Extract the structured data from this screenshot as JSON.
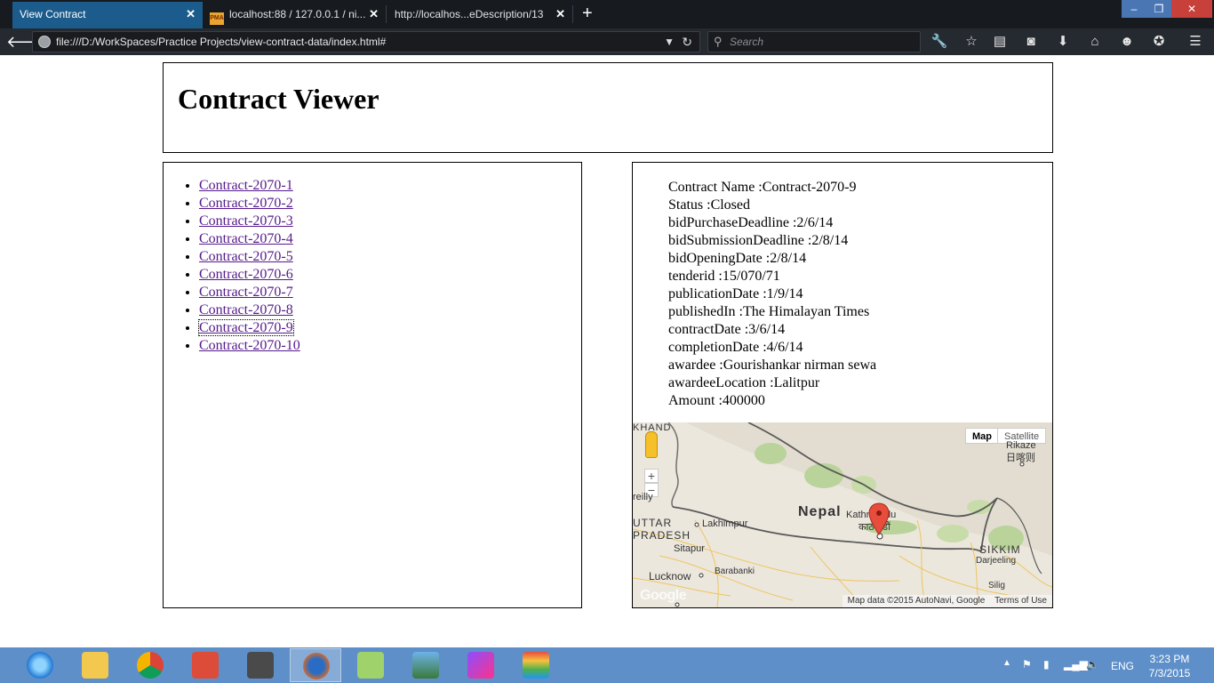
{
  "browser": {
    "tabs": [
      {
        "label": "View Contract",
        "active": true
      },
      {
        "label": "localhost:88 / 127.0.0.1 / ni...",
        "active": false,
        "favicon": "PMA"
      },
      {
        "label": "http://localhos...eDescription/13",
        "active": false
      }
    ],
    "new_tab": "+",
    "url": "file:///D:/WorkSpaces/Practice Projects/view-contract-data/index.html#",
    "search_placeholder": "Search",
    "window_controls": {
      "minimize": "–",
      "restore": "❐",
      "close": "✕"
    }
  },
  "page": {
    "title": "Contract Viewer",
    "contracts": [
      "Contract-2070-1",
      "Contract-2070-2",
      "Contract-2070-3",
      "Contract-2070-4",
      "Contract-2070-5",
      "Contract-2070-6",
      "Contract-2070-7",
      "Contract-2070-8",
      "Contract-2070-9",
      "Contract-2070-10"
    ],
    "selected_contract": "Contract-2070-9",
    "details": [
      "Contract Name :Contract-2070-9",
      "Status :Closed",
      "bidPurchaseDeadline :2/6/14",
      "bidSubmissionDeadline :2/8/14",
      "bidOpeningDate :2/8/14",
      "tenderid :15/070/71",
      "publicationDate :1/9/14",
      "publishedIn :The Himalayan Times",
      "contractDate :3/6/14",
      "completionDate :4/6/14",
      "awardee :Gourishankar nirman sewa",
      "awardeeLocation :Lalitpur",
      "Amount :400000"
    ],
    "map": {
      "type_buttons": [
        "Map",
        "Satellite"
      ],
      "zoom_in": "+",
      "zoom_out": "−",
      "labels": {
        "country": "Nepal",
        "city": "Kathmandu",
        "city_local": "काठमाडौं",
        "region1": "UTTAR",
        "region2": "PRADESH",
        "region3": "KHAND",
        "sikkim": "SIKKIM",
        "lakhimpur": "Lakhimpur",
        "sitapur": "Sitapur",
        "barabanki": "Barabanki",
        "lucknow": "Lucknow",
        "darjeeling": "Darjeeling",
        "rikaze": "Rikaze",
        "rikaze_cn": "日喀则",
        "bareilly": "reilly",
        "siliguri": "Silig"
      },
      "attribution": "Map data ©2015 AutoNavi, Google",
      "terms": "Terms of Use",
      "logo": "Google"
    }
  },
  "taskbar": {
    "apps": [
      "internet-explorer",
      "file-explorer",
      "chrome",
      "todoist",
      "sublime-text",
      "firefox",
      "notepad-plus-plus",
      "photo-viewer",
      "phpstorm",
      "bluestacks"
    ],
    "active_app": "firefox",
    "language": "ENG",
    "time": "3:23 PM",
    "date": "7/3/2015"
  }
}
